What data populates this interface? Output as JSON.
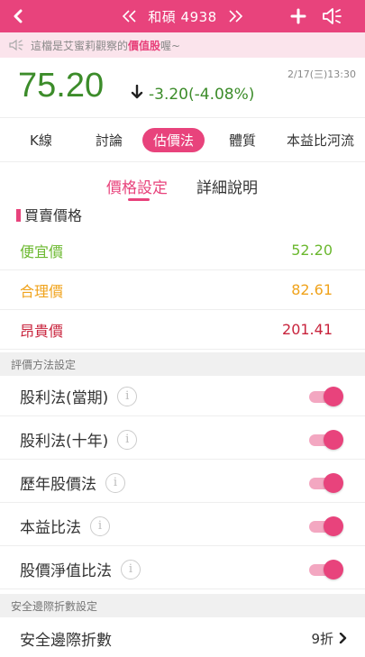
{
  "header": {
    "title": "和碩 4938",
    "prev_icon": "double-chevron-left",
    "next_icon": "double-chevron-right",
    "back_icon": "chevron-left",
    "add_icon": "plus",
    "speaker_icon": "speaker"
  },
  "notice": {
    "prefix": "這檔是艾蜜莉觀察的",
    "highlight": "價值股",
    "suffix": "喔~"
  },
  "quote": {
    "price": "75.20",
    "change": "-3.20(-4.08%)",
    "direction": "down",
    "time": "2/17(三)13:30"
  },
  "tabs": [
    {
      "label": "K線",
      "active": false
    },
    {
      "label": "討論",
      "active": false
    },
    {
      "label": "估價法",
      "active": true
    },
    {
      "label": "體質",
      "active": false
    },
    {
      "label": "本益比河流",
      "active": false
    }
  ],
  "subtabs": [
    {
      "label": "價格設定",
      "active": true
    },
    {
      "label": "詳細說明",
      "active": false
    }
  ],
  "buy_price": {
    "heading": "買賣價格",
    "rows": [
      {
        "label": "便宜價",
        "value": "52.20",
        "color": "#6bb82f"
      },
      {
        "label": "合理價",
        "value": "82.61",
        "color": "#f0a31c"
      },
      {
        "label": "昂貴價",
        "value": "201.41",
        "color": "#c8233c"
      }
    ]
  },
  "method_settings": {
    "heading": "評價方法設定",
    "items": [
      {
        "label": "股利法(當期)",
        "enabled": true
      },
      {
        "label": "股利法(十年)",
        "enabled": true
      },
      {
        "label": "歷年股價法",
        "enabled": true
      },
      {
        "label": "本益比法",
        "enabled": true
      },
      {
        "label": "股價淨值比法",
        "enabled": true
      }
    ],
    "info_glyph": "i"
  },
  "safety": {
    "heading": "安全邊際折數設定",
    "label": "安全邊際折數",
    "value": "9折"
  },
  "colors": {
    "accent": "#e8437c",
    "up_down_green": "#3c8c2a"
  }
}
